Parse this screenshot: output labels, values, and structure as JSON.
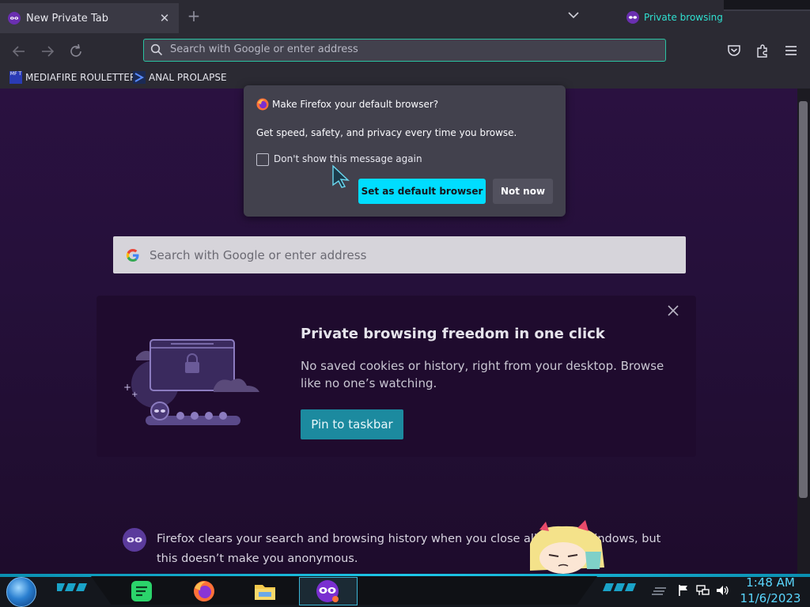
{
  "tab": {
    "title": "New Private Tab",
    "close": "✕",
    "new_tab": "+"
  },
  "private_indicator": {
    "label": "Private browsing"
  },
  "urlbar": {
    "placeholder": "Search with Google or enter address"
  },
  "bookmarks": [
    {
      "label": "MEDIAFIRE ROULETTER",
      "favicon_text": "MF T"
    },
    {
      "label": "ANAL PROLAPSE"
    }
  ],
  "popup": {
    "title": "Make Firefox your default browser?",
    "description": "Get speed, safety, and privacy every time you browse.",
    "checkbox_label": "Don't show this message again",
    "checkbox_checked": false,
    "primary_button": "Set as default browser",
    "secondary_button": "Not now"
  },
  "search": {
    "placeholder": "Search with Google or enter address"
  },
  "promo": {
    "title": "Private browsing freedom in one click",
    "text": "No saved cookies or history, right from your desktop. Browse like no one’s watching.",
    "button": "Pin to taskbar"
  },
  "notice": {
    "text": "Firefox clears your search and browsing history when you close all private windows, but this doesn’t make you anonymous."
  },
  "taskbar": {
    "apps": [
      "notes-app",
      "firefox",
      "file-explorer",
      "firefox-private"
    ],
    "clock_time": "1:48 AM",
    "clock_date": "11/6/2023"
  },
  "colors": {
    "accent": "#00ddff",
    "private_purple": "#8000d7",
    "url_focus": "#2ac3a2",
    "clock": "#5ad7ff"
  }
}
